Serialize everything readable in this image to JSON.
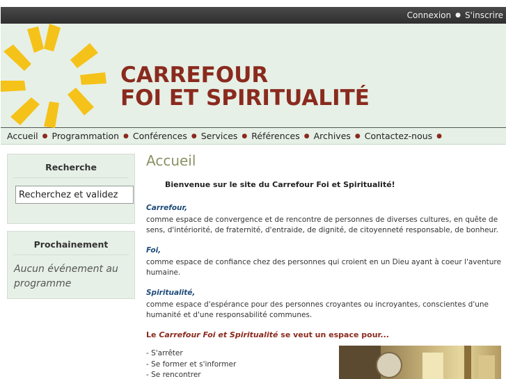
{
  "topbar": {
    "login": "Connexion",
    "register": "S'inscrire"
  },
  "brand": {
    "line1": "CARREFOUR",
    "line2": "FOI ET SPIRITUALITÉ"
  },
  "nav": [
    "Accueil",
    "Programmation",
    "Conférences",
    "Services",
    "Références",
    "Archives",
    "Contactez-nous"
  ],
  "sidebar": {
    "search": {
      "title": "Recherche",
      "value": "Recherchez et validez"
    },
    "upcoming": {
      "title": "Prochainement",
      "text": "Aucun événement au programme"
    }
  },
  "main": {
    "title": "Accueil",
    "welcome": "Bienvenue sur le site du Carrefour Foi et Spiritualité!",
    "sections": [
      {
        "keyword": "Carrefour,",
        "text": "comme espace de convergence et de rencontre de personnes de diverses cultures, en quête de sens, d'intériorité, de fraternité, d'entraide, de dignité, de citoyenneté responsable, de bonheur."
      },
      {
        "keyword": "Foi,",
        "text": "comme espace de confiance chez des personnes qui croient en un Dieu ayant à coeur l'aventure humaine."
      },
      {
        "keyword": "Spiritualité,",
        "text": "comme espace d'espérance pour des personnes croyantes ou incroyantes, conscientes d'une humanité et d'une responsabilité communes."
      }
    ],
    "lead_prefix": "Le ",
    "lead_em": "Carrefour Foi et Spiritualité",
    "lead_suffix": " se veut un espace pour...",
    "list": [
      "- S'arrêter",
      "- Se former et s'informer",
      "- Se rencontrer"
    ]
  },
  "colors": {
    "brand": "#8a2a1e",
    "header_bg": "#e6f0e6",
    "rays": "#f5c219",
    "keyword": "#1e4b7a",
    "title": "#8b9164"
  }
}
